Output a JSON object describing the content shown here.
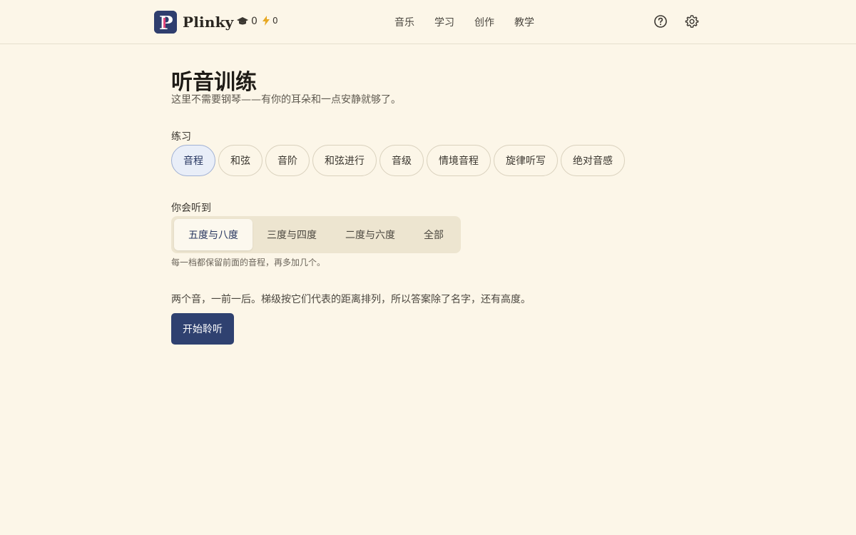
{
  "header": {
    "brand": "Plinky",
    "logo_letter": "P",
    "graduation_count": "0",
    "bolt_count": "0",
    "nav": [
      {
        "label": "音乐"
      },
      {
        "label": "学习"
      },
      {
        "label": "创作"
      },
      {
        "label": "教学"
      }
    ],
    "icons": {
      "help": "question-circle-icon",
      "settings": "gear-icon",
      "graduation": "graduation-cap-icon",
      "bolt": "lightning-bolt-icon"
    }
  },
  "page": {
    "title": "听音训练",
    "subtitle": "这里不需要钢琴——有你的耳朵和一点安静就够了。"
  },
  "practice": {
    "label": "练习",
    "options": [
      {
        "label": "音程",
        "selected": true
      },
      {
        "label": "和弦",
        "selected": false
      },
      {
        "label": "音阶",
        "selected": false
      },
      {
        "label": "和弦进行",
        "selected": false
      },
      {
        "label": "音级",
        "selected": false
      },
      {
        "label": "情境音程",
        "selected": false
      },
      {
        "label": "旋律听写",
        "selected": false
      },
      {
        "label": "绝对音感",
        "selected": false
      }
    ]
  },
  "hear": {
    "label": "你会听到",
    "options": [
      {
        "label": "五度与八度",
        "selected": true
      },
      {
        "label": "三度与四度",
        "selected": false
      },
      {
        "label": "二度与六度",
        "selected": false
      },
      {
        "label": "全部",
        "selected": false
      }
    ],
    "hint": "每一档都保留前面的音程，再多加几个。"
  },
  "description": "两个音，一前一后。梯级按它们代表的距离排列，所以答案除了名字，还有高度。",
  "start_button": "开始聆听",
  "colors": {
    "background": "#fcf6e8",
    "accent": "#2f4170",
    "chip_active_bg": "#e9eef8",
    "logo_pink": "#e0457b"
  }
}
